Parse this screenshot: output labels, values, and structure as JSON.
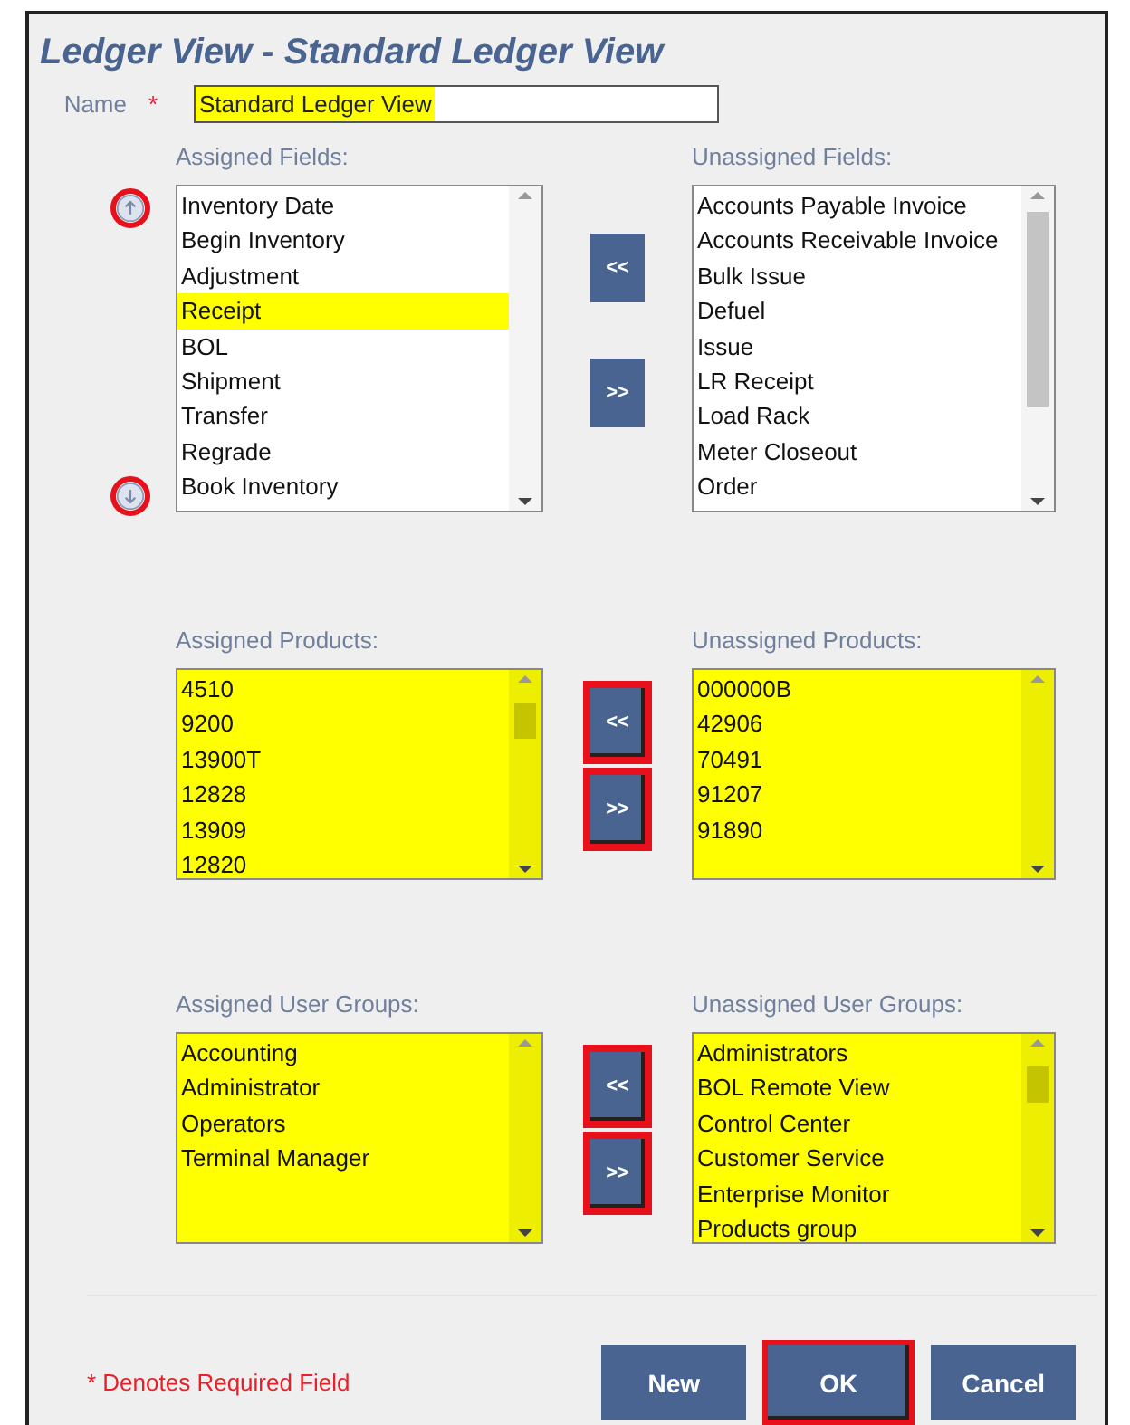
{
  "title": "Ledger View - Standard Ledger View",
  "name_field": {
    "label": "Name",
    "required_mark": "*",
    "value": "Standard Ledger View",
    "highlighted": true
  },
  "sections": [
    {
      "reorder": {
        "up_highlighted": true,
        "down_highlighted": true
      },
      "left": {
        "label": "Assigned Fields:",
        "highlighted": false,
        "scrollable": false,
        "items": [
          {
            "text": "Inventory Date",
            "selected": false
          },
          {
            "text": "Begin Inventory",
            "selected": false
          },
          {
            "text": "Adjustment",
            "selected": false
          },
          {
            "text": "Receipt",
            "selected": true
          },
          {
            "text": "BOL",
            "selected": false
          },
          {
            "text": "Shipment",
            "selected": false
          },
          {
            "text": "Transfer",
            "selected": false
          },
          {
            "text": "Regrade",
            "selected": false
          },
          {
            "text": "Book Inventory",
            "selected": false
          }
        ]
      },
      "buttons": [
        {
          "label": "<<",
          "highlighted": false
        },
        {
          "label": ">>",
          "highlighted": false
        }
      ],
      "right": {
        "label": "Unassigned Fields:",
        "highlighted": false,
        "scrollable": true,
        "items": [
          {
            "text": "Accounts Payable Invoice",
            "selected": false
          },
          {
            "text": "Accounts Receivable Invoice",
            "selected": false
          },
          {
            "text": "Bulk Issue",
            "selected": false
          },
          {
            "text": "Defuel",
            "selected": false
          },
          {
            "text": "Issue",
            "selected": false
          },
          {
            "text": "LR Receipt",
            "selected": false
          },
          {
            "text": "Load Rack",
            "selected": false
          },
          {
            "text": "Meter Closeout",
            "selected": false
          },
          {
            "text": "Order",
            "selected": false
          }
        ]
      }
    },
    {
      "left": {
        "label": "Assigned Products:",
        "highlighted": true,
        "scrollable": true,
        "items": [
          {
            "text": "4510"
          },
          {
            "text": "9200"
          },
          {
            "text": "13900T"
          },
          {
            "text": "12828"
          },
          {
            "text": "13909"
          },
          {
            "text": "12820"
          }
        ]
      },
      "buttons": [
        {
          "label": "<<",
          "highlighted": true
        },
        {
          "label": ">>",
          "highlighted": true
        }
      ],
      "right": {
        "label": "Unassigned Products:",
        "highlighted": true,
        "scrollable": false,
        "items": [
          {
            "text": "000000B"
          },
          {
            "text": "42906"
          },
          {
            "text": "70491"
          },
          {
            "text": "91207"
          },
          {
            "text": "91890"
          }
        ]
      }
    },
    {
      "left": {
        "label": "Assigned User Groups:",
        "highlighted": true,
        "scrollable": false,
        "items": [
          {
            "text": "Accounting"
          },
          {
            "text": "Administrator"
          },
          {
            "text": "Operators"
          },
          {
            "text": "Terminal Manager"
          }
        ]
      },
      "buttons": [
        {
          "label": "<<",
          "highlighted": true
        },
        {
          "label": ">>",
          "highlighted": true
        }
      ],
      "right": {
        "label": "Unassigned User Groups:",
        "highlighted": true,
        "scrollable": true,
        "items": [
          {
            "text": "Administrators"
          },
          {
            "text": "BOL Remote View"
          },
          {
            "text": "Control Center"
          },
          {
            "text": "Customer Service"
          },
          {
            "text": "Enterprise Monitor"
          },
          {
            "text": "Products group"
          }
        ]
      }
    }
  ],
  "required_note": "* Denotes Required Field",
  "buttons": [
    {
      "label": "New",
      "highlighted": false
    },
    {
      "label": "OK",
      "highlighted": true
    },
    {
      "label": "Cancel",
      "highlighted": false
    }
  ]
}
